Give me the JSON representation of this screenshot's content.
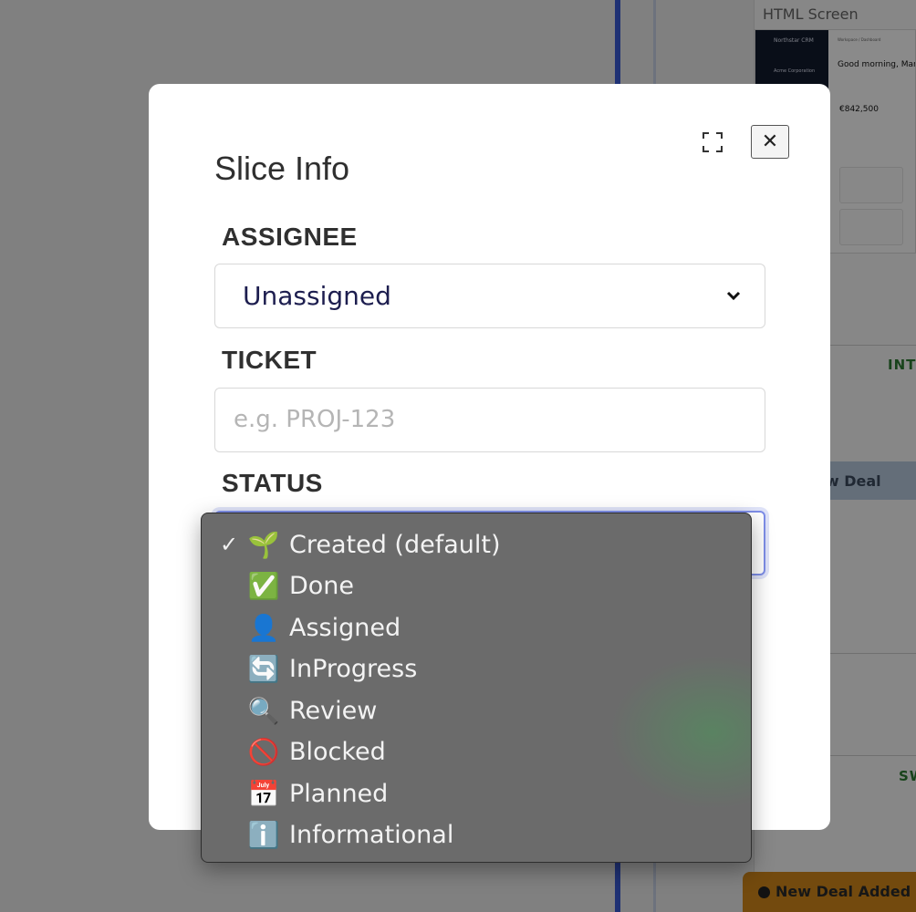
{
  "background": {
    "panel_title": "HTML Screen",
    "thumb_brand": "Northstar CRM",
    "thumb_org": "Acme Corporation",
    "thumb_crumb": "Workspace / Dashboard",
    "thumb_greeting": "Good morning, Martin",
    "thumb_metric": "€842,500",
    "label_int": "INT",
    "new_deal_strip": "ew Deal",
    "label_sw": "SW",
    "toast_text": "New Deal Added"
  },
  "modal": {
    "title": "Slice Info",
    "assignee": {
      "label": "ASSIGNEE",
      "value": "Unassigned"
    },
    "ticket": {
      "label": "TICKET",
      "placeholder": "e.g. PROJ-123"
    },
    "status": {
      "label": "STATUS",
      "options": [
        {
          "label": "Created (default)",
          "emoji": "🌱",
          "selected": true
        },
        {
          "label": "Done",
          "emoji": "✅",
          "selected": false
        },
        {
          "label": "Assigned",
          "emoji": "👤",
          "selected": false
        },
        {
          "label": "InProgress",
          "emoji": "🔄",
          "selected": false
        },
        {
          "label": "Review",
          "emoji": "🔍",
          "selected": false
        },
        {
          "label": "Blocked",
          "emoji": "🚫",
          "selected": false
        },
        {
          "label": "Planned",
          "emoji": "📅",
          "selected": false
        },
        {
          "label": "Informational",
          "emoji": "ℹ️",
          "selected": false
        }
      ]
    }
  },
  "colors": {
    "modal_bg": "#ffffff",
    "menu_bg": "#6b6b6b",
    "focus_ring": "#7e8ee8",
    "select_text": "#1d1e4f"
  }
}
